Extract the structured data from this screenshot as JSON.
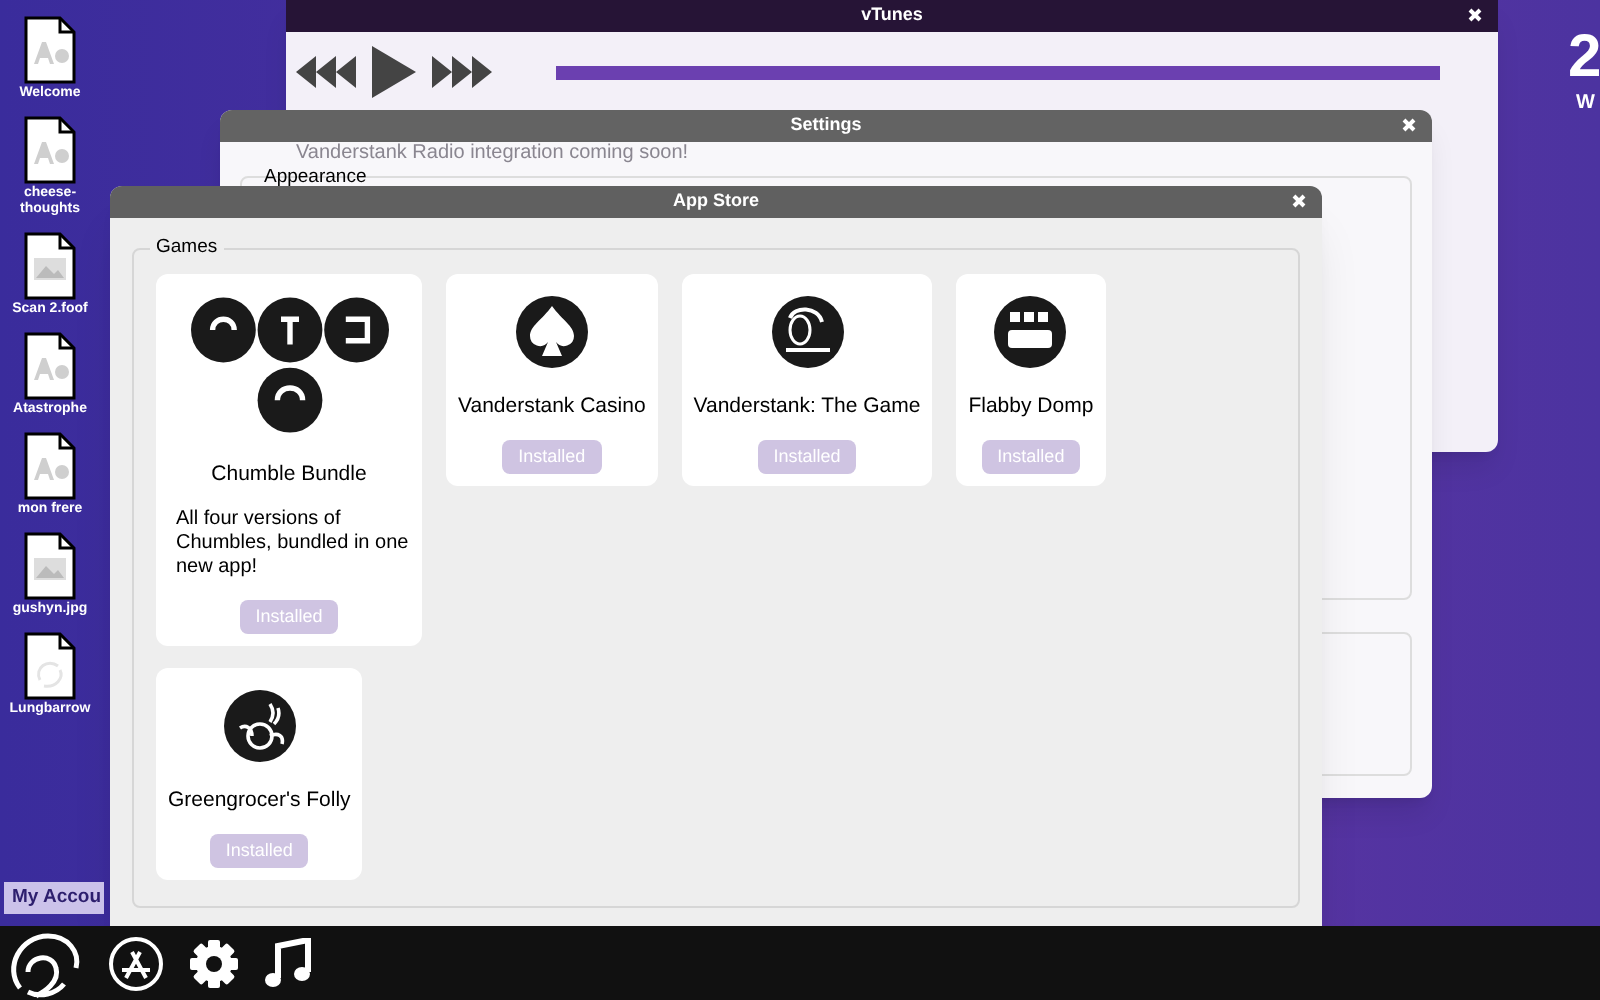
{
  "desktop_icons": [
    {
      "label": "Welcome",
      "kind": "text"
    },
    {
      "label": "cheese-thoughts",
      "kind": "text"
    },
    {
      "label": "Scan 2.foof",
      "kind": "image"
    },
    {
      "label": "Atastrophe",
      "kind": "text"
    },
    {
      "label": "mon frere",
      "kind": "text"
    },
    {
      "label": "gushyn.jpg",
      "kind": "image"
    },
    {
      "label": "Lungbarrow",
      "kind": "swirl"
    }
  ],
  "account_button": "My Accou",
  "clock": {
    "time": "2",
    "day": "W"
  },
  "vtunes": {
    "title": "vTunes",
    "progress": {
      "level": 1
    },
    "notice": "Vanderstank Radio integration coming soon!"
  },
  "settings": {
    "title": "Settings",
    "section": "Appearance"
  },
  "app_store": {
    "title": "App Store",
    "group": "Games",
    "apps": [
      {
        "name": "Chumble Bundle",
        "kind": "chumble",
        "description": "All four versions of Chumbles, bundled in one new app!",
        "button": "Installed",
        "installed": true
      },
      {
        "name": "Vanderstank Casino",
        "kind": "spade",
        "button": "Installed",
        "installed": true
      },
      {
        "name": "Vanderstank: The Game",
        "kind": "game",
        "button": "Installed",
        "installed": true
      },
      {
        "name": "Flabby Domp",
        "kind": "flabby",
        "button": "Installed",
        "installed": true
      },
      {
        "name": "Greengrocer's Folly",
        "kind": "fruit",
        "button": "Installed",
        "installed": true
      }
    ]
  },
  "taskbar": [
    {
      "kind": "logo"
    },
    {
      "kind": "store"
    },
    {
      "kind": "settings"
    },
    {
      "kind": "music"
    }
  ]
}
